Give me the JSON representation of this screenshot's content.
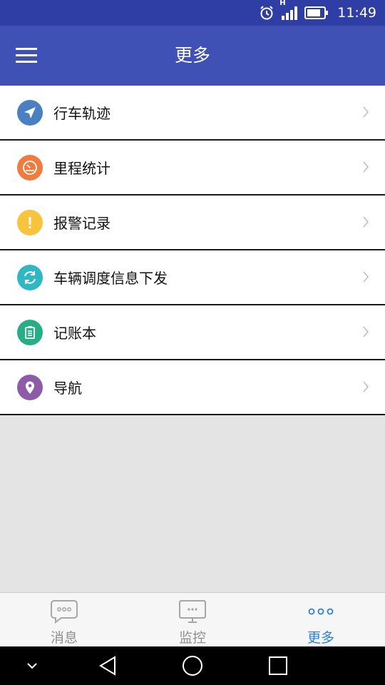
{
  "status_bar": {
    "time": "11:49",
    "network_label": "H"
  },
  "header": {
    "title": "更多"
  },
  "menu_items": [
    {
      "label": "行车轨迹",
      "icon": "navigation-arrow-icon",
      "color": "#4a7fc1"
    },
    {
      "label": "里程统计",
      "icon": "speedometer-icon",
      "color": "#f07b3f"
    },
    {
      "label": "报警记录",
      "icon": "alert-icon",
      "color": "#f8c33d"
    },
    {
      "label": "车辆调度信息下发",
      "icon": "refresh-circle-icon",
      "color": "#2fb8c3"
    },
    {
      "label": "记账本",
      "icon": "notebook-icon",
      "color": "#27ae86"
    },
    {
      "label": "导航",
      "icon": "location-pin-icon",
      "color": "#8e5ba8"
    }
  ],
  "tabs": [
    {
      "label": "消息",
      "icon": "chat-icon",
      "active": false
    },
    {
      "label": "监控",
      "icon": "monitor-icon",
      "active": false
    },
    {
      "label": "更多",
      "icon": "more-dots-icon",
      "active": true
    }
  ],
  "colors": {
    "status_bar": "#2e3ea4",
    "app_bar": "#3f51b5",
    "active_tab": "#2d7fd6",
    "inactive_tab": "#8f8f8f",
    "background": "#e4e4e4"
  }
}
